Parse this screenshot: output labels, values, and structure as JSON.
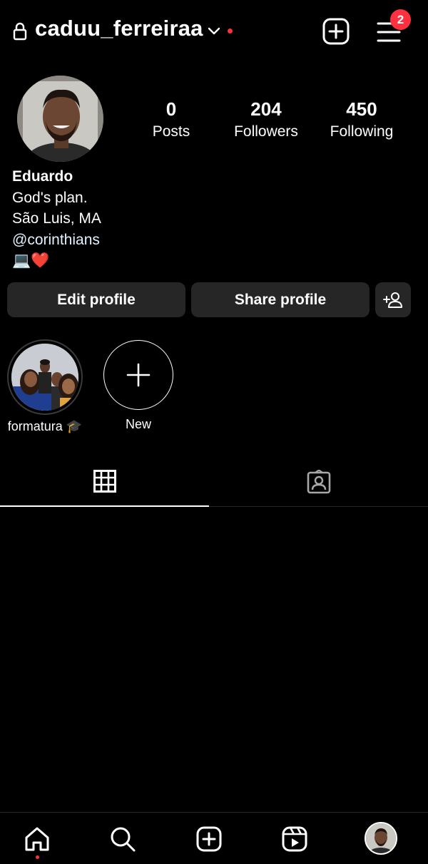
{
  "header": {
    "username": "caduu_ferreiraa",
    "notification_count": "2",
    "icons": {
      "lock": "lock-icon",
      "dropdown": "chevron-down-icon",
      "create": "plus-square-icon",
      "menu": "hamburger-menu-icon"
    }
  },
  "stats": {
    "posts": {
      "value": "0",
      "label": "Posts"
    },
    "followers": {
      "value": "204",
      "label": "Followers"
    },
    "following": {
      "value": "450",
      "label": "Following"
    }
  },
  "bio": {
    "name": "Eduardo",
    "line1": "God's plan.",
    "line2": "São Luis, MA",
    "mention": "@corinthians",
    "emoji": "💻❤️"
  },
  "actions": {
    "edit_label": "Edit profile",
    "share_label": "Share profile"
  },
  "highlights": [
    {
      "label": "formatura 🎓"
    },
    {
      "label": "New"
    }
  ],
  "tabs": [
    {
      "icon": "grid-icon",
      "active": true
    },
    {
      "icon": "tagged-icon",
      "active": false
    }
  ],
  "bottom_nav": [
    {
      "icon": "home-icon",
      "active": true
    },
    {
      "icon": "search-icon"
    },
    {
      "icon": "create-icon"
    },
    {
      "icon": "reels-icon"
    },
    {
      "icon": "profile-avatar"
    }
  ],
  "colors": {
    "background": "#000000",
    "button_bg": "#262626",
    "badge": "#ff3040",
    "link": "#e0f1ff"
  }
}
